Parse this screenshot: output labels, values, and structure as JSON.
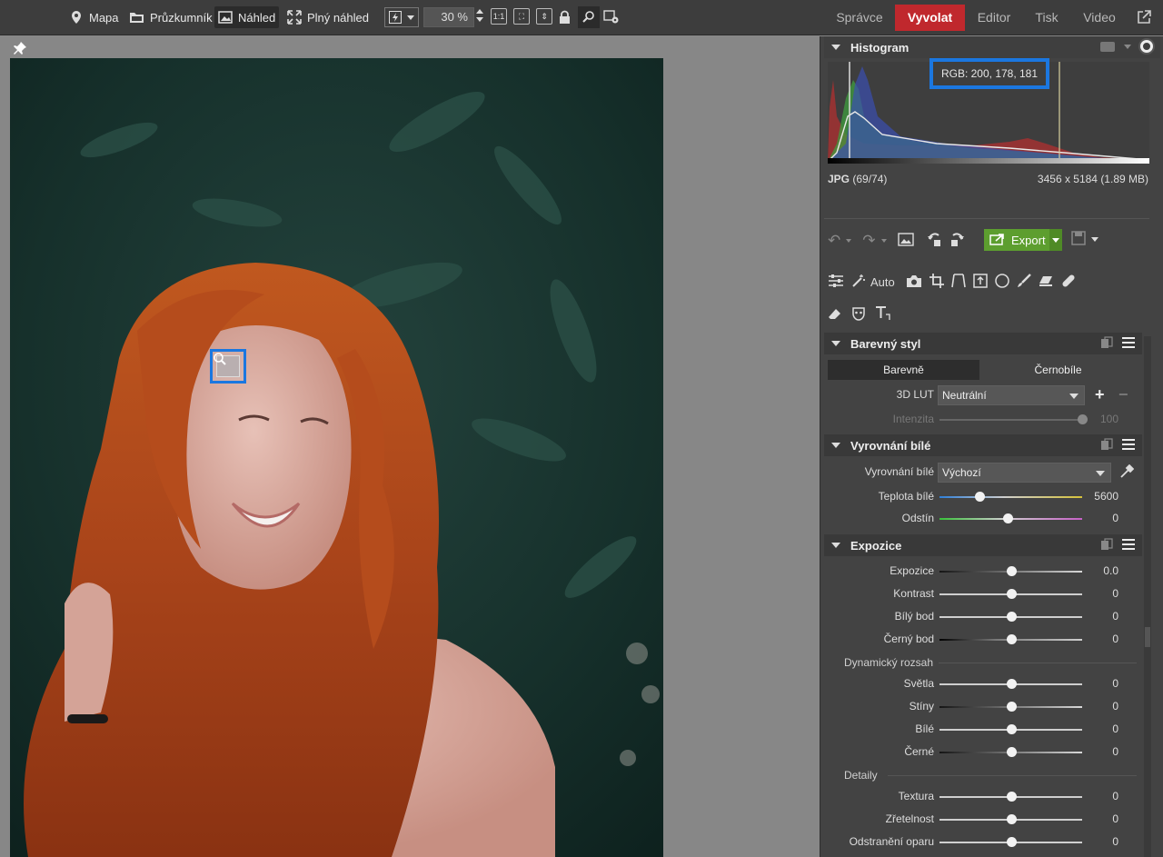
{
  "toolbar": {
    "map": "Mapa",
    "explorer": "Průzkumník",
    "preview": "Náhled",
    "full_preview": "Plný náhled",
    "zoom": "30 %",
    "one_to_one": "1:1"
  },
  "modules": {
    "manager": "Správce",
    "develop": "Vyvolat",
    "editor": "Editor",
    "print": "Tisk",
    "video": "Video"
  },
  "histogram": {
    "title": "Histogram",
    "rgb_readout": "RGB: 200, 178, 181",
    "format": "JPG",
    "index": "(69/74)",
    "dimensions": "3456 x 5184 (1.89 MB)"
  },
  "actions": {
    "export": "Export"
  },
  "tools": {
    "auto": "Auto"
  },
  "color_style": {
    "title": "Barevný styl",
    "tab_color": "Barevně",
    "tab_bw": "Černobíle",
    "lut_label": "3D LUT",
    "lut_value": "Neutrální",
    "intensity_label": "Intenzita",
    "intensity_value": "100"
  },
  "white_balance": {
    "title": "Vyrovnání bílé",
    "wb_label": "Vyrovnání bílé",
    "wb_value": "Výchozí",
    "temp_label": "Teplota bílé",
    "temp_value": "5600",
    "tint_label": "Odstín",
    "tint_value": "0"
  },
  "exposure": {
    "title": "Expozice",
    "exposure_label": "Expozice",
    "exposure_value": "0.0",
    "contrast_label": "Kontrast",
    "contrast_value": "0",
    "white_point_label": "Bílý bod",
    "white_point_value": "0",
    "black_point_label": "Černý bod",
    "black_point_value": "0",
    "dynamic_range": "Dynamický rozsah",
    "highlights_label": "Světla",
    "highlights_value": "0",
    "shadows_label": "Stíny",
    "shadows_value": "0",
    "whites_label": "Bílé",
    "whites_value": "0",
    "blacks_label": "Černé",
    "blacks_value": "0",
    "details": "Detaily",
    "texture_label": "Textura",
    "texture_value": "0",
    "clarity_label": "Zřetelnost",
    "clarity_value": "0",
    "dehaze_label": "Odstranění oparu",
    "dehaze_value": "0"
  },
  "levels": {
    "intensity": 1.0,
    "temperature": 0.28,
    "tint": 0.48,
    "sliders_centered": 0.5
  },
  "colors": {
    "accent_red": "#c0282d",
    "highlight_blue": "#1b77e0",
    "export_green": "#5d9e2f"
  },
  "icons": [
    "map-pin-icon",
    "folder-icon",
    "image-icon",
    "expand-icon",
    "flash-icon",
    "lock-icon",
    "search-icon",
    "settings-icon",
    "undo-icon",
    "redo-icon",
    "export-icon",
    "save-icon",
    "camera-icon",
    "crop-icon",
    "brush-icon",
    "circle-icon",
    "bandage-icon",
    "text-icon"
  ]
}
